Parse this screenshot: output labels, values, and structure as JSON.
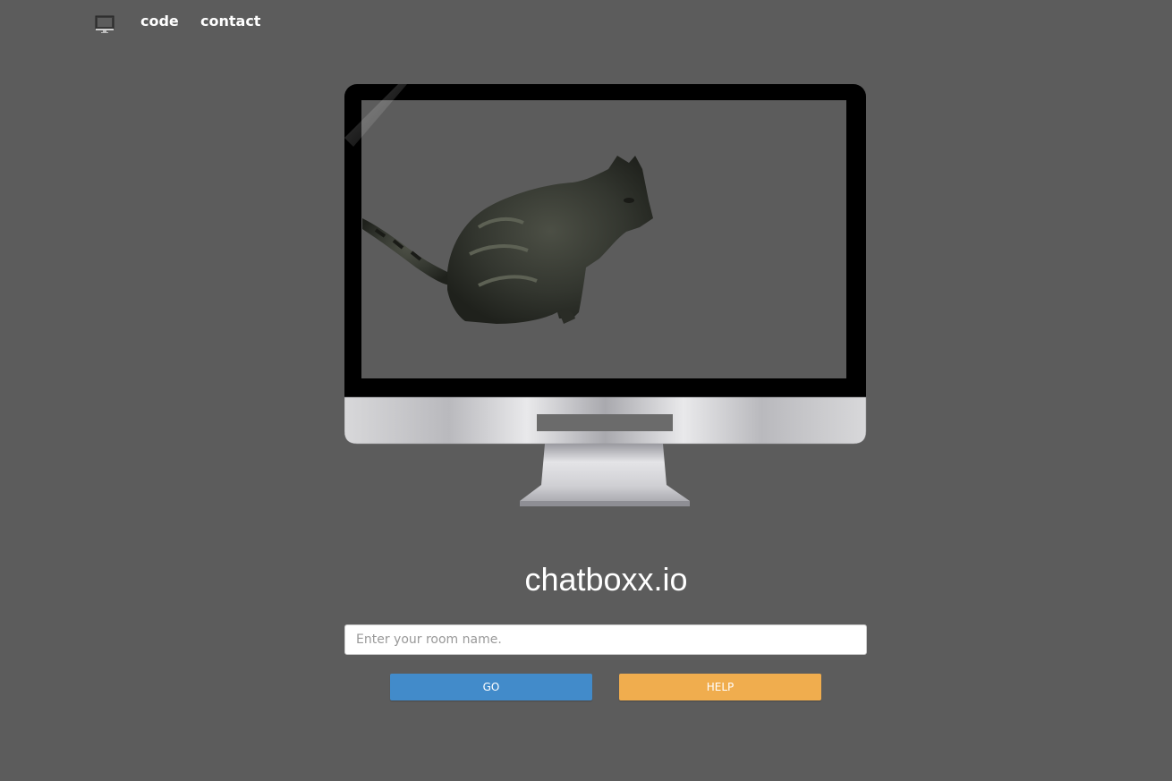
{
  "nav": {
    "logo_icon": "monitor-icon",
    "links": [
      {
        "label": "code"
      },
      {
        "label": "contact"
      }
    ]
  },
  "hero": {
    "image_description_icon": "cat-on-monitor-illustration"
  },
  "main": {
    "title": "chatboxx.io",
    "room_input": {
      "value": "",
      "placeholder": "Enter your room name."
    },
    "go_button": {
      "label": "GO",
      "color": "#428bca"
    },
    "help_button": {
      "label": "HELP",
      "color": "#f0ad4e"
    }
  },
  "colors": {
    "background": "#5c5c5c"
  }
}
